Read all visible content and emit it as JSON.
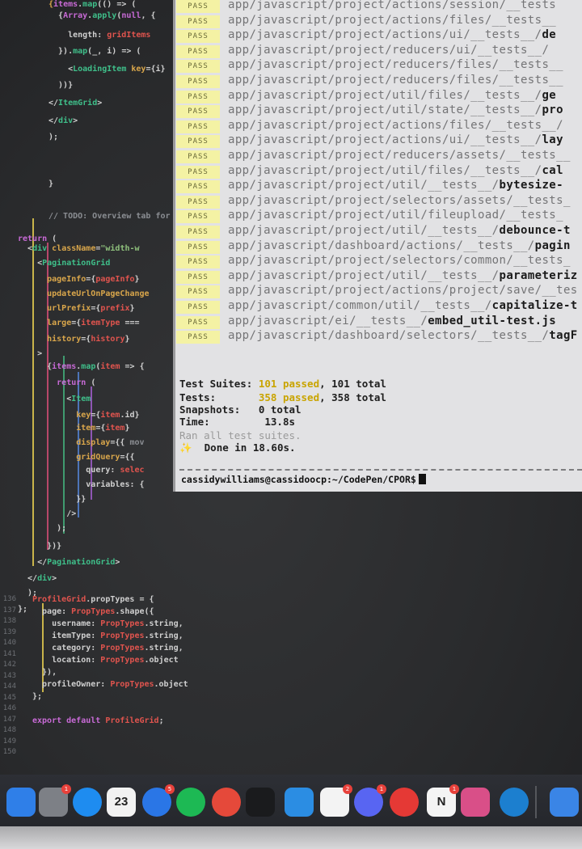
{
  "editor": {
    "line_numbers": [
      "136",
      "137",
      "138",
      "139",
      "140",
      "141",
      "142",
      "143",
      "144",
      "145",
      "146",
      "147",
      "148",
      "149",
      "150"
    ],
    "top_lines": [
      {
        "id": "l1",
        "parts": [
          [
            "t-attr",
            "{"
          ],
          [
            "t-kw",
            "items"
          ],
          [
            "t-plain",
            "."
          ],
          [
            "t-tag",
            "map"
          ],
          [
            "t-plain",
            "(() => ("
          ]
        ]
      },
      {
        "id": "l2",
        "parts": [
          [
            "t-plain",
            "  {"
          ],
          [
            "t-kw",
            "Array"
          ],
          [
            "t-plain",
            "."
          ],
          [
            "t-tag",
            "apply"
          ],
          [
            "t-plain",
            "("
          ],
          [
            "t-kw",
            "null"
          ],
          [
            "t-plain",
            ", {"
          ]
        ]
      },
      {
        "id": "l3",
        "parts": [
          [
            "t-plain",
            "    length: "
          ],
          [
            "t-var",
            "gridItems"
          ]
        ]
      },
      {
        "id": "l4",
        "parts": [
          [
            "t-plain",
            "  })."
          ],
          [
            "t-tag",
            "map"
          ],
          [
            "t-plain",
            "(_, i) => ("
          ]
        ]
      },
      {
        "id": "l5",
        "parts": [
          [
            "t-plain",
            "    <"
          ],
          [
            "t-tag",
            "LoadingItem"
          ],
          [
            "t-plain",
            " "
          ],
          [
            "t-attr",
            "key"
          ],
          [
            "t-plain",
            "={i}"
          ]
        ]
      },
      {
        "id": "l6",
        "parts": [
          [
            "t-plain",
            "  ))}"
          ]
        ]
      },
      {
        "id": "l7",
        "parts": [
          [
            "t-plain",
            "</"
          ],
          [
            "t-tag",
            "ItemGrid"
          ],
          [
            "t-plain",
            ">"
          ]
        ]
      },
      {
        "id": "l8",
        "parts": [
          [
            "t-plain",
            "</"
          ],
          [
            "t-tag",
            "div"
          ],
          [
            "t-plain",
            ">"
          ]
        ]
      },
      {
        "id": "l9",
        "parts": [
          [
            "t-plain",
            ");"
          ]
        ]
      },
      {
        "id": "l10",
        "parts": [
          [
            "t-plain",
            "}"
          ]
        ]
      },
      {
        "id": "l11",
        "parts": [
          [
            "t-dim",
            "// TODO: Overview tab for"
          ]
        ]
      },
      {
        "id": "l12",
        "parts": [
          [
            "t-kw",
            "return"
          ],
          [
            "t-plain",
            " ("
          ]
        ]
      },
      {
        "id": "l13",
        "parts": [
          [
            "t-plain",
            "  <"
          ],
          [
            "t-tag",
            "div"
          ],
          [
            "t-plain",
            " "
          ],
          [
            "t-attr",
            "className"
          ],
          [
            "t-plain",
            "="
          ],
          [
            "t-str",
            "\"width-w"
          ]
        ]
      },
      {
        "id": "l14",
        "parts": [
          [
            "t-plain",
            "    <"
          ],
          [
            "t-tag",
            "PaginationGrid"
          ]
        ]
      },
      {
        "id": "l15",
        "parts": [
          [
            "t-attr",
            "      pageInfo"
          ],
          [
            "t-plain",
            "={"
          ],
          [
            "t-var",
            "pageInfo"
          ],
          [
            "t-plain",
            "}"
          ]
        ]
      },
      {
        "id": "l16",
        "parts": [
          [
            "t-attr",
            "      updateUrlOnPageChange"
          ]
        ]
      },
      {
        "id": "l17",
        "parts": [
          [
            "t-attr",
            "      urlPrefix"
          ],
          [
            "t-plain",
            "={"
          ],
          [
            "t-var",
            "prefix"
          ],
          [
            "t-plain",
            "}"
          ]
        ]
      },
      {
        "id": "l18",
        "parts": [
          [
            "t-attr",
            "      large"
          ],
          [
            "t-plain",
            "={"
          ],
          [
            "t-var",
            "itemType"
          ],
          [
            "t-plain",
            " ==="
          ]
        ]
      },
      {
        "id": "l19",
        "parts": [
          [
            "t-attr",
            "      history"
          ],
          [
            "t-plain",
            "={"
          ],
          [
            "t-var",
            "history"
          ],
          [
            "t-plain",
            "}"
          ]
        ]
      },
      {
        "id": "l20",
        "parts": [
          [
            "t-plain",
            "    >"
          ]
        ]
      },
      {
        "id": "l21",
        "parts": [
          [
            "t-plain",
            "      {"
          ],
          [
            "t-kw",
            "items"
          ],
          [
            "t-plain",
            "."
          ],
          [
            "t-tag",
            "map"
          ],
          [
            "t-plain",
            "("
          ],
          [
            "t-var",
            "item"
          ],
          [
            "t-plain",
            " => {"
          ]
        ]
      },
      {
        "id": "l22",
        "parts": [
          [
            "t-kw",
            "        return"
          ],
          [
            "t-plain",
            " ("
          ]
        ]
      },
      {
        "id": "l23",
        "parts": [
          [
            "t-plain",
            "          <"
          ],
          [
            "t-tag",
            "Item"
          ]
        ]
      },
      {
        "id": "l24",
        "parts": [
          [
            "t-attr",
            "            key"
          ],
          [
            "t-plain",
            "={"
          ],
          [
            "t-var",
            "item"
          ],
          [
            "t-plain",
            ".id}"
          ]
        ]
      },
      {
        "id": "l25",
        "parts": [
          [
            "t-attr",
            "            item"
          ],
          [
            "t-plain",
            "={"
          ],
          [
            "t-var",
            "item"
          ],
          [
            "t-plain",
            "}"
          ]
        ]
      },
      {
        "id": "l26",
        "parts": [
          [
            "t-attr",
            "            display"
          ],
          [
            "t-plain",
            "={{ "
          ],
          [
            "t-dim",
            "mov"
          ]
        ]
      },
      {
        "id": "l27",
        "parts": [
          [
            "t-attr",
            "            gridQuery"
          ],
          [
            "t-plain",
            "={{"
          ]
        ]
      },
      {
        "id": "l28",
        "parts": [
          [
            "t-plain",
            "              query: "
          ],
          [
            "t-var",
            "selec"
          ]
        ]
      },
      {
        "id": "l29",
        "parts": [
          [
            "t-plain",
            "              variables: {"
          ]
        ]
      },
      {
        "id": "l30",
        "parts": [
          [
            "t-plain",
            "            }}"
          ]
        ]
      },
      {
        "id": "l31",
        "parts": [
          [
            "t-plain",
            "          />"
          ]
        ]
      },
      {
        "id": "l32",
        "parts": [
          [
            "t-plain",
            "        );"
          ]
        ]
      },
      {
        "id": "l33",
        "parts": [
          [
            "t-plain",
            "      })}"
          ]
        ]
      },
      {
        "id": "l34",
        "parts": [
          [
            "t-plain",
            "    </"
          ],
          [
            "t-tag",
            "PaginationGrid"
          ],
          [
            "t-plain",
            ">"
          ]
        ]
      },
      {
        "id": "l35",
        "parts": [
          [
            "t-plain",
            "  </"
          ],
          [
            "t-tag",
            "div"
          ],
          [
            "t-plain",
            ">"
          ]
        ]
      },
      {
        "id": "l36",
        "parts": [
          [
            "t-plain",
            "  );"
          ]
        ]
      },
      {
        "id": "l37",
        "parts": [
          [
            "t-plain",
            "};"
          ]
        ]
      }
    ],
    "bottom_lines": [
      {
        "id": "b1",
        "parts": [
          [
            "t-var",
            "ProfileGrid"
          ],
          [
            "t-plain",
            ".propTypes = {"
          ]
        ]
      },
      {
        "id": "b2",
        "parts": [
          [
            "t-plain",
            "  page: "
          ],
          [
            "t-var",
            "PropTypes"
          ],
          [
            "t-plain",
            ".shape({"
          ]
        ]
      },
      {
        "id": "b3",
        "parts": [
          [
            "t-plain",
            "    username: "
          ],
          [
            "t-var",
            "PropTypes"
          ],
          [
            "t-plain",
            ".string,"
          ]
        ]
      },
      {
        "id": "b4",
        "parts": [
          [
            "t-plain",
            "    itemType: "
          ],
          [
            "t-var",
            "PropTypes"
          ],
          [
            "t-plain",
            ".string,"
          ]
        ]
      },
      {
        "id": "b5",
        "parts": [
          [
            "t-plain",
            "    category: "
          ],
          [
            "t-var",
            "PropTypes"
          ],
          [
            "t-plain",
            ".string,"
          ]
        ]
      },
      {
        "id": "b6",
        "parts": [
          [
            "t-plain",
            "    location: "
          ],
          [
            "t-var",
            "PropTypes"
          ],
          [
            "t-plain",
            ".object"
          ]
        ]
      },
      {
        "id": "b7",
        "parts": [
          [
            "t-plain",
            "  }),"
          ]
        ]
      },
      {
        "id": "b8",
        "parts": [
          [
            "t-plain",
            "  profileOwner: "
          ],
          [
            "t-var",
            "PropTypes"
          ],
          [
            "t-plain",
            ".object"
          ]
        ]
      },
      {
        "id": "b9",
        "parts": [
          [
            "t-plain",
            "};"
          ]
        ]
      },
      {
        "id": "b10",
        "parts": [
          [
            "t-plain",
            ""
          ]
        ]
      },
      {
        "id": "b11",
        "parts": [
          [
            "t-kw",
            "export default"
          ],
          [
            "t-plain",
            " "
          ],
          [
            "t-var",
            "ProfileGrid"
          ],
          [
            "t-plain",
            ";"
          ]
        ]
      }
    ]
  },
  "terminal": {
    "pass_label": "PASS",
    "test_files": [
      {
        "dir": "app/javascript/project/actions/session/__tests",
        "file": ""
      },
      {
        "dir": "app/javascript/project/actions/files/__tests__",
        "file": ""
      },
      {
        "dir": "app/javascript/project/actions/ui/__tests__/",
        "file": "de"
      },
      {
        "dir": "app/javascript/project/reducers/ui/__tests__/",
        "file": ""
      },
      {
        "dir": "app/javascript/project/reducers/files/__tests__",
        "file": ""
      },
      {
        "dir": "app/javascript/project/reducers/files/__tests__",
        "file": ""
      },
      {
        "dir": "app/javascript/project/util/files/__tests__/",
        "file": "ge"
      },
      {
        "dir": "app/javascript/project/util/state/__tests__/",
        "file": "pro"
      },
      {
        "dir": "app/javascript/project/actions/files/__tests__/",
        "file": ""
      },
      {
        "dir": "app/javascript/project/actions/ui/__tests__/",
        "file": "lay"
      },
      {
        "dir": "app/javascript/project/reducers/assets/__tests__",
        "file": ""
      },
      {
        "dir": "app/javascript/project/util/files/__tests__/",
        "file": "cal"
      },
      {
        "dir": "app/javascript/project/util/__tests__/",
        "file": "bytesize-"
      },
      {
        "dir": "app/javascript/project/selectors/assets/__tests_",
        "file": ""
      },
      {
        "dir": "app/javascript/project/util/fileupload/__tests_",
        "file": ""
      },
      {
        "dir": "app/javascript/project/util/__tests__/",
        "file": "debounce-t"
      },
      {
        "dir": "app/javascript/dashboard/actions/__tests__/",
        "file": "pagin"
      },
      {
        "dir": "app/javascript/project/selectors/common/__tests_",
        "file": ""
      },
      {
        "dir": "app/javascript/project/util/__tests__/",
        "file": "parameteriz"
      },
      {
        "dir": "app/javascript/project/actions/project/save/__tes",
        "file": ""
      },
      {
        "dir": "app/javascript/common/util/__tests__/",
        "file": "capitalize-t"
      },
      {
        "dir": "app/javascript/ei/__tests__/",
        "file": "embed_util-test.js"
      },
      {
        "dir": "app/javascript/dashboard/selectors/__tests__/",
        "file": "tagF"
      }
    ],
    "summary": {
      "suites_label": "Test Suites:",
      "suites_passed": "101 passed",
      "suites_total": ", 101 total",
      "tests_label": "Tests:",
      "tests_passed": "358 passed",
      "tests_total": ", 358 total",
      "snapshots_label": "Snapshots:",
      "snapshots_value": "0 total",
      "time_label": "Time:",
      "time_value": "13.8s",
      "ran_all": "Ran all test suites.",
      "done_icon": "✨",
      "done": "Done in 18.60s."
    },
    "prompt": "cassidywilliams@cassidoocp:~/CodePen/CPOR$"
  },
  "dock": {
    "apps": [
      {
        "name": "finder-icon",
        "color": "#2f7fe8",
        "badge": ""
      },
      {
        "name": "system-preferences-icon",
        "color": "#7d8086",
        "badge": "1"
      },
      {
        "name": "app-store-icon",
        "color": "#1e8cf0",
        "badge": ""
      },
      {
        "name": "calendar-icon",
        "color": "#f2f2f2",
        "badge": "",
        "text": "23"
      },
      {
        "name": "messenger-icon",
        "color": "#2a76e6",
        "badge": "5"
      },
      {
        "name": "spotify-icon",
        "color": "#1db954",
        "badge": ""
      },
      {
        "name": "chrome-icon",
        "color": "#e5493a",
        "badge": ""
      },
      {
        "name": "terminal-icon",
        "color": "#1a1b1d",
        "badge": ""
      },
      {
        "name": "vscode-icon",
        "color": "#2b8de3",
        "badge": ""
      },
      {
        "name": "slack-icon",
        "color": "#f3f3f3",
        "badge": "2"
      },
      {
        "name": "discord-icon",
        "color": "#5865f2",
        "badge": "1"
      },
      {
        "name": "pocket-casts-icon",
        "color": "#e53935",
        "badge": ""
      },
      {
        "name": "notion-icon",
        "color": "#f4f4f4",
        "badge": "1",
        "text": "N"
      },
      {
        "name": "photos-icon",
        "color": "#d94f88",
        "badge": ""
      },
      {
        "name": "edge-icon",
        "color": "#1c7fcf",
        "badge": ""
      },
      {
        "name": "downloads-icon",
        "color": "#3a85e6",
        "badge": ""
      }
    ]
  }
}
